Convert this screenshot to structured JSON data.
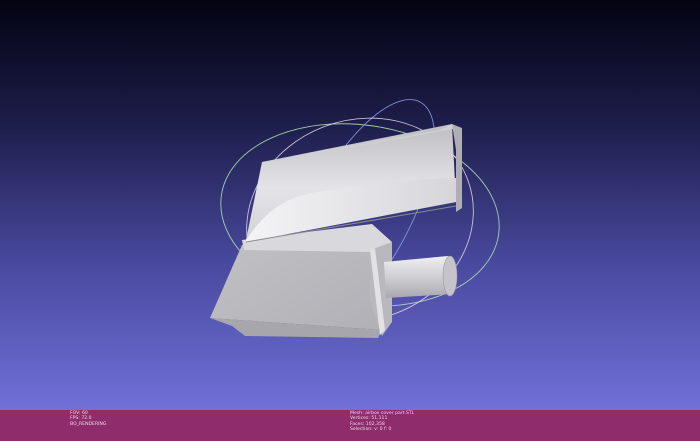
{
  "viewport": {
    "background_top": "#030312",
    "background_bottom": "#7070d8",
    "model_color": "#c8c8cc",
    "trackball_colors": [
      "#b8e4b0",
      "#9aaaf0",
      "#f0e4ec"
    ]
  },
  "status": {
    "left": [
      "FOV: 60",
      "FPS:  72.0",
      "BO_RENDERING"
    ],
    "right": [
      "Mesh: airbox cover part.STL",
      "Vertices: 51,111",
      "Faces: 102,358",
      "Selection: v: 0 f: 0"
    ]
  },
  "status_color": "#8e2c6c"
}
